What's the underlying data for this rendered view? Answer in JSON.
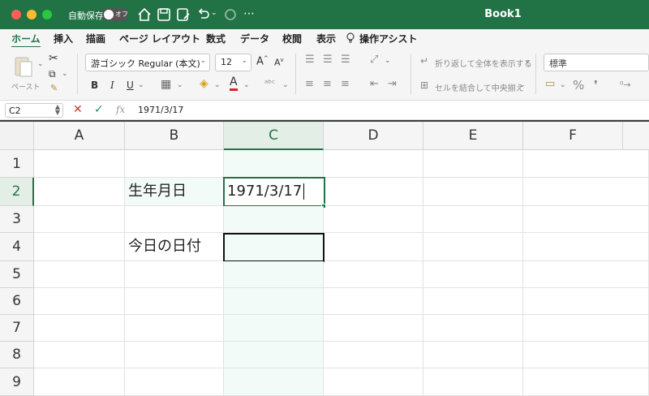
{
  "window": {
    "title": "Book1",
    "autosave_label": "自動保存",
    "autosave_state": "オフ",
    "accent_color": "#217346"
  },
  "toolbar_icons": [
    "home-icon",
    "save-icon",
    "save-edit-icon",
    "undo-icon",
    "redo-icon",
    "more-icon"
  ],
  "menu": {
    "items": [
      "ホーム",
      "挿入",
      "描画",
      "ページ レイアウト",
      "数式",
      "データ",
      "校閲",
      "表示"
    ],
    "assist": "操作アシスト",
    "active_index": 0
  },
  "ribbon": {
    "paste_label": "ペースト",
    "font_name": "游ゴシック Regular (本文)",
    "font_size": "12",
    "bold": "B",
    "italic": "I",
    "underline": "U",
    "font_color_glyph": "A",
    "wrap_text": "折り返して全体を表示する",
    "merge_center": "セルを結合して中央揃え",
    "number_format": "標準"
  },
  "formula_bar": {
    "name_box": "C2",
    "content": "1971/3/17"
  },
  "grid": {
    "columns": [
      "A",
      "B",
      "C",
      "D",
      "E",
      "F"
    ],
    "rows": [
      "1",
      "2",
      "3",
      "4",
      "5",
      "6",
      "7",
      "8",
      "9"
    ],
    "selected_column": "C",
    "selected_row": "2",
    "cells": {
      "B2": "生年月日",
      "C2": "1971/3/17",
      "B4": "今日の日付",
      "C4": ""
    }
  }
}
